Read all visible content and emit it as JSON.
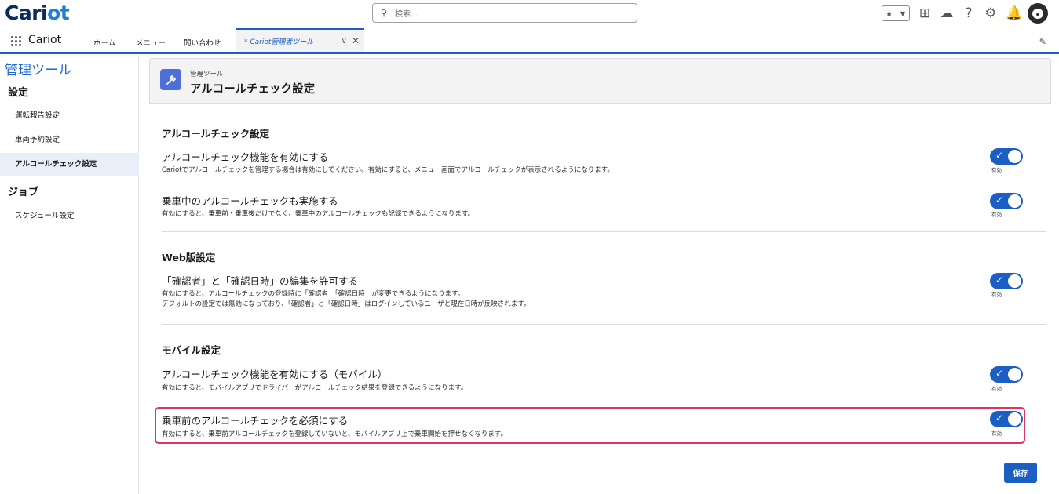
{
  "header": {
    "logo_main": "Cari",
    "logo_accent": "ot",
    "search_placeholder": "検索..."
  },
  "nav": {
    "app_name": "Cariot",
    "items": [
      "ホーム",
      "メニュー",
      "問い合わせ"
    ],
    "active_tab_label": "* Cariot管理者ツール"
  },
  "sidebar": {
    "title": "管理ツール",
    "sections": [
      {
        "heading": "設定",
        "items": [
          "運転報告設定",
          "車両予約設定",
          "アルコールチェック設定"
        ]
      },
      {
        "heading": "ジョブ",
        "items": [
          "スケジュール設定"
        ]
      }
    ],
    "active_item": "アルコールチェック設定"
  },
  "page": {
    "subtitle": "管理ツール",
    "title": "アルコールチェック設定"
  },
  "sections": [
    {
      "title": "アルコールチェック設定",
      "settings": [
        {
          "label": "アルコールチェック機能を有効にする",
          "desc": [
            "Cariotでアルコールチェックを管理する場合は有効にしてください。有効にすると、メニュー画面でアルコールチェックが表示されるようになります。"
          ],
          "enabled": true,
          "caption": "有効"
        },
        {
          "label": "乗車中のアルコールチェックも実施する",
          "desc": [
            "有効にすると、乗車前・乗車後だけでなく、乗車中のアルコールチェックも記録できるようになります。"
          ],
          "enabled": true,
          "caption": "有効"
        }
      ]
    },
    {
      "title": "Web版設定",
      "settings": [
        {
          "label": "「確認者」と「確認日時」の編集を許可する",
          "desc": [
            "有効にすると、アルコールチェックの登録時に「確認者」「確認日時」が変更できるようになります。",
            "デフォルトの設定では無効になっており、「確認者」と「確認日時」はログインしているユーザと現在日時が反映されます。"
          ],
          "enabled": true,
          "caption": "有効"
        }
      ]
    },
    {
      "title": "モバイル設定",
      "settings": [
        {
          "label": "アルコールチェック機能を有効にする（モバイル）",
          "desc": [
            "有効にすると、モバイルアプリでドライバーがアルコールチェック結果を登録できるようになります。"
          ],
          "enabled": true,
          "caption": "有効"
        },
        {
          "label": "乗車前のアルコールチェックを必須にする",
          "desc": [
            "有効にすると、乗車前アルコールチェックを登録していないと、モバイルアプリ上で乗車開始を押せなくなります。"
          ],
          "enabled": true,
          "caption": "有効",
          "highlighted": true
        }
      ]
    }
  ],
  "save_label": "保存",
  "colors": {
    "brand_blue": "#1b5fc4",
    "highlight": "#e0335f",
    "logo_dark": "#0b2a5e"
  }
}
